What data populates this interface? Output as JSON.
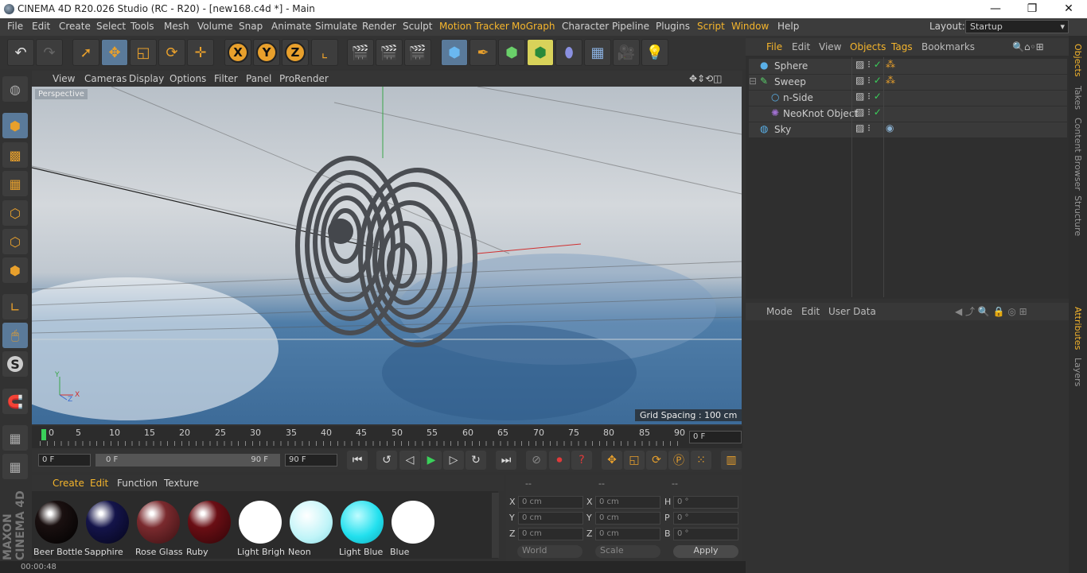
{
  "titlebar": {
    "title": "CINEMA 4D R20.026 Studio (RC - R20) - [new168.c4d *] - Main",
    "min": "—",
    "max": "❐",
    "close": "✕"
  },
  "menubar": {
    "items": [
      "File",
      "Edit",
      "Create",
      "Select",
      "Tools",
      "Mesh",
      "Volume",
      "Snap",
      "Animate",
      "Simulate",
      "Render",
      "Sculpt",
      "Motion Tracker",
      "MoGraph",
      "Character",
      "Pipeline",
      "Plugins",
      "Script",
      "Window",
      "Help"
    ],
    "layout_label": "Layout:",
    "layout_value": "Startup"
  },
  "viewport": {
    "menu": [
      "View",
      "Cameras",
      "Display",
      "Options",
      "Filter",
      "Panel",
      "ProRender"
    ],
    "camera_label": "Perspective",
    "grid_spacing": "Grid Spacing : 100 cm",
    "axis": {
      "y": "Y",
      "z": "Z",
      "x": "X"
    }
  },
  "timeline": {
    "ticks": [
      "0",
      "5",
      "10",
      "15",
      "20",
      "25",
      "30",
      "35",
      "40",
      "45",
      "50",
      "55",
      "60",
      "65",
      "70",
      "75",
      "80",
      "85",
      "90"
    ],
    "current_frame": "0 F"
  },
  "transport": {
    "start": "0 F",
    "range_start": "0 F",
    "range_end": "90 F",
    "end": "90 F"
  },
  "materials": {
    "menu": [
      "Create",
      "Edit",
      "Function",
      "Texture"
    ],
    "items": [
      {
        "name": "Beer Bottle",
        "color": "#1a1010"
      },
      {
        "name": "Sapphire",
        "color": "#14144a"
      },
      {
        "name": "Rose Glass",
        "color": "#7a2a2e"
      },
      {
        "name": "Ruby",
        "color": "#6a0e14"
      },
      {
        "name": "Light Brigh",
        "color": "#ffffff"
      },
      {
        "name": "Neon",
        "color": "#bff4f8"
      },
      {
        "name": "Light Blue",
        "color": "#22e0ee"
      },
      {
        "name": "Blue",
        "color": "#ffffff"
      }
    ]
  },
  "coords": {
    "headers": [
      "--",
      "--",
      "--"
    ],
    "rows": [
      {
        "a": "X",
        "av": "0 cm",
        "b": "X",
        "bv": "0 cm",
        "c": "H",
        "cv": "0 °"
      },
      {
        "a": "Y",
        "av": "0 cm",
        "b": "Y",
        "bv": "0 cm",
        "c": "P",
        "cv": "0 °"
      },
      {
        "a": "Z",
        "av": "0 cm",
        "b": "Z",
        "bv": "0 cm",
        "c": "B",
        "cv": "0 °"
      }
    ],
    "world": "World",
    "scale": "Scale",
    "apply": "Apply"
  },
  "objects": {
    "menu": [
      "File",
      "Edit",
      "View",
      "Objects",
      "Tags",
      "Bookmarks"
    ],
    "items": [
      {
        "name": "Sphere",
        "icon_color": "#5ab0e8"
      },
      {
        "name": "Sweep",
        "icon_color": "#5ad06a"
      },
      {
        "name": "n-Side",
        "icon_color": "#5ab0e8"
      },
      {
        "name": "NeoKnot Object",
        "icon_color": "#a070d0"
      },
      {
        "name": "Sky",
        "icon_color": "#5ab0e8"
      }
    ]
  },
  "attributes": {
    "menu": [
      "Mode",
      "Edit",
      "User Data"
    ]
  },
  "right_tabs": [
    "Objects",
    "Takes",
    "Content Browser",
    "Structure",
    "Attributes",
    "Layers"
  ],
  "status": {
    "time": "00:00:48"
  },
  "colors": {
    "accent": "#f5b52c",
    "panel": "#323232"
  }
}
